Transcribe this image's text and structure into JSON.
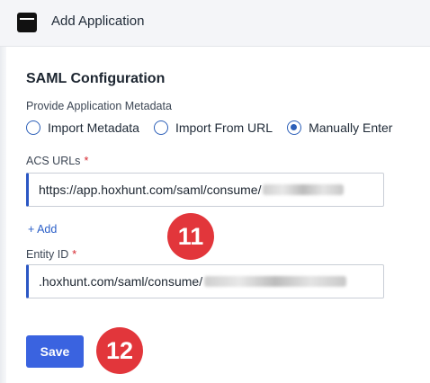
{
  "header": {
    "title": "Add Application",
    "icon": "window-icon"
  },
  "section": {
    "title": "SAML Configuration"
  },
  "metadata": {
    "label": "Provide Application Metadata",
    "options": [
      {
        "label": "Import Metadata",
        "selected": false
      },
      {
        "label": "Import From URL",
        "selected": false
      },
      {
        "label": "Manually Enter",
        "selected": true
      }
    ]
  },
  "acs": {
    "label": "ACS URLs",
    "required_mark": "*",
    "value": "https://app.hoxhunt.com/saml/consume/",
    "add_label": "+ Add"
  },
  "entity": {
    "label": "Entity ID",
    "required_mark": "*",
    "value": ".hoxhunt.com/saml/consume/"
  },
  "actions": {
    "save_label": "Save"
  },
  "annotations": {
    "step_11": "11",
    "step_12": "12"
  },
  "colors": {
    "accent": "#3a63e0",
    "badge": "#e2363b",
    "required": "#d6282f"
  }
}
